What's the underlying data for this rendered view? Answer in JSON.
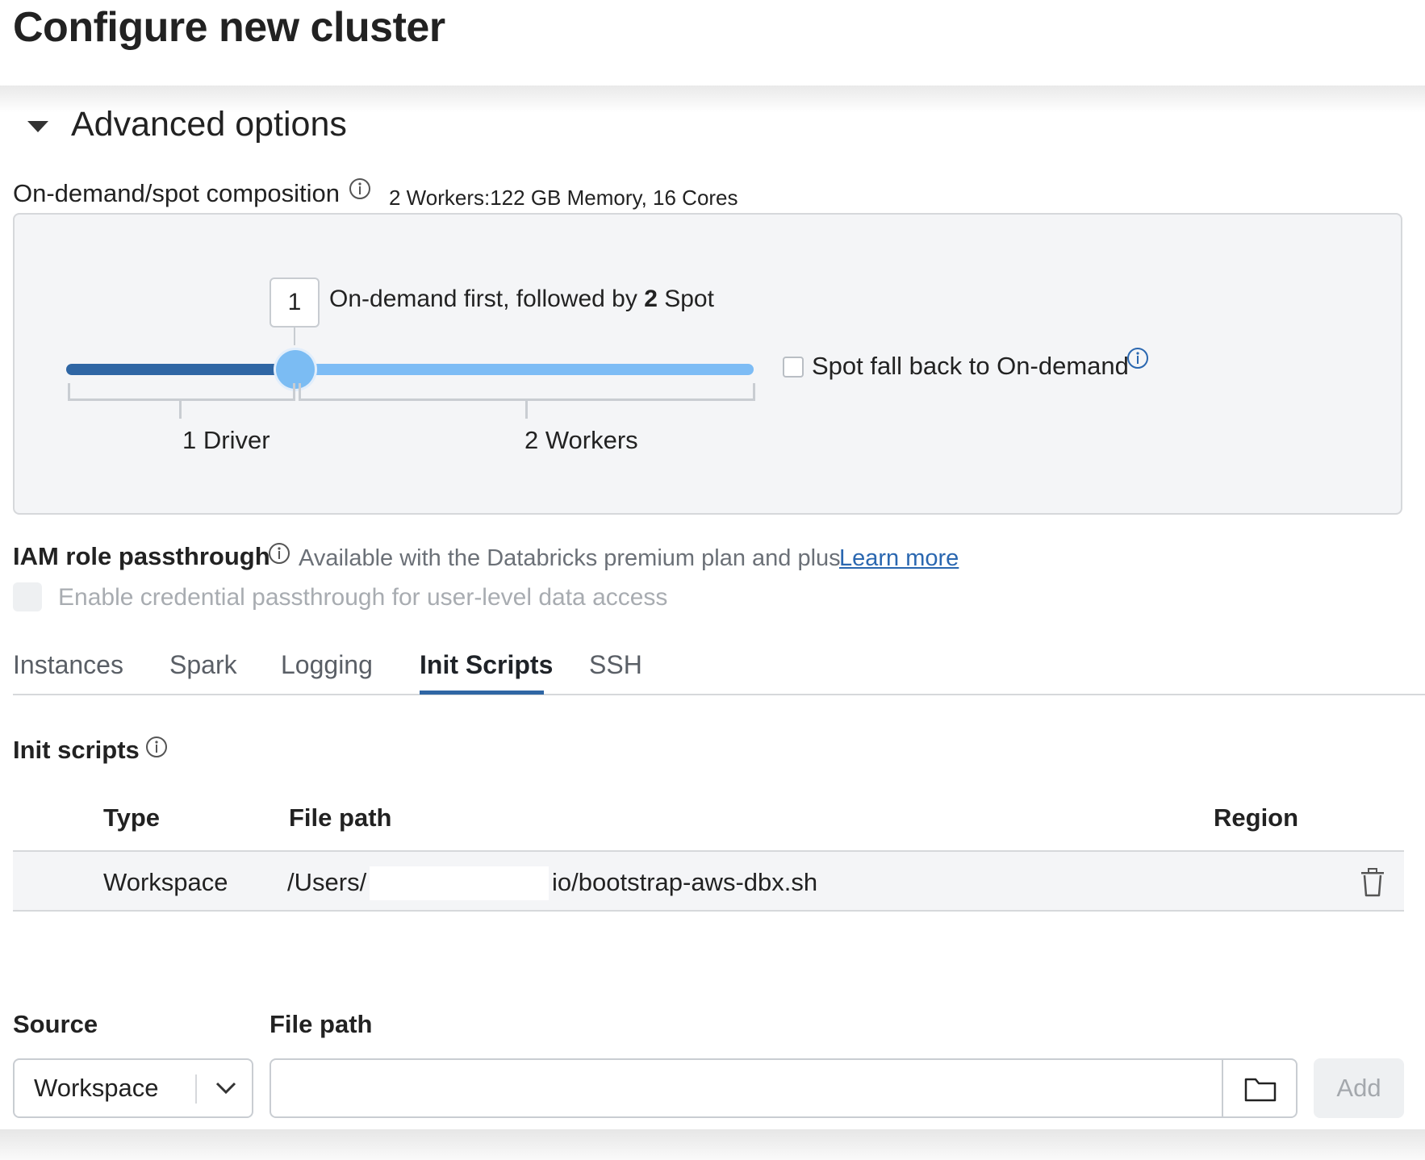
{
  "page": {
    "title": "Configure new cluster"
  },
  "advanced": {
    "title": "Advanced options"
  },
  "composition": {
    "label": "On-demand/spot composition",
    "summary": "2 Workers:122 GB Memory, 16 Cores",
    "on_demand_count": "1",
    "text_prefix": "On-demand first, followed by",
    "spot_count": "2",
    "text_suffix": "Spot",
    "driver_label": "1 Driver",
    "workers_label": "2 Workers",
    "fallback_label": "Spot fall back to On-demand",
    "fallback_checked": false
  },
  "iam": {
    "title": "IAM role passthrough",
    "note": "Available with the Databricks premium plan and plus",
    "learn_more": "Learn more",
    "credential_label": "Enable credential passthrough for user-level data access",
    "credential_checked": false
  },
  "tabs": [
    {
      "label": "Instances",
      "active": false
    },
    {
      "label": "Spark",
      "active": false
    },
    {
      "label": "Logging",
      "active": false
    },
    {
      "label": "Init Scripts",
      "active": true
    },
    {
      "label": "SSH",
      "active": false
    }
  ],
  "init_scripts": {
    "title": "Init scripts",
    "columns": [
      "Type",
      "File path",
      "Region"
    ],
    "rows": [
      {
        "type": "Workspace",
        "path_prefix": "/Users/",
        "path_suffix": "io/bootstrap-aws-dbx.sh",
        "region": ""
      }
    ]
  },
  "add_form": {
    "source_label": "Source",
    "source_value": "Workspace",
    "filepath_label": "File path",
    "filepath_value": "",
    "add_label": "Add"
  },
  "colors": {
    "accent": "#2f66a4",
    "slider_light": "#7dbcf5",
    "info_icon": "#2a67b0"
  },
  "icons": [
    "chevron-down-icon",
    "info-icon",
    "trash-icon",
    "folder-icon",
    "caret-down-icon"
  ]
}
